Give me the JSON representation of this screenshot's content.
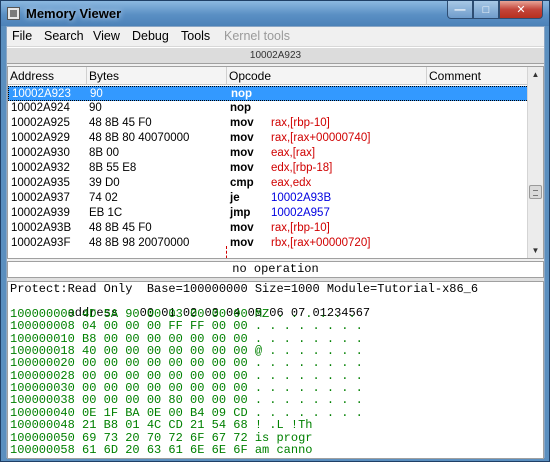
{
  "window": {
    "title": "Memory Viewer"
  },
  "menu": {
    "items": [
      "File",
      "Search",
      "View",
      "Debug",
      "Tools",
      "Kernel tools"
    ]
  },
  "address_bar": "10002A923",
  "disassembly": {
    "columns": [
      "Address",
      "Bytes",
      "Opcode",
      "Comment"
    ],
    "rows": [
      {
        "address": "10002A923",
        "bytes": "90",
        "mnemonic": "nop",
        "operands": "",
        "operand_color": "red",
        "selected": true
      },
      {
        "address": "10002A924",
        "bytes": "90",
        "mnemonic": "nop",
        "operands": "",
        "operand_color": "red",
        "selected": false
      },
      {
        "address": "10002A925",
        "bytes": "48 8B 45 F0",
        "mnemonic": "mov",
        "operands": "rax,[rbp-10]",
        "operand_color": "red",
        "selected": false
      },
      {
        "address": "10002A929",
        "bytes": "48 8B 80 40070000",
        "mnemonic": "mov",
        "operands": "rax,[rax+00000740]",
        "operand_color": "red",
        "selected": false
      },
      {
        "address": "10002A930",
        "bytes": "8B 00",
        "mnemonic": "mov",
        "operands": "eax,[rax]",
        "operand_color": "red",
        "selected": false
      },
      {
        "address": "10002A932",
        "bytes": "8B 55 E8",
        "mnemonic": "mov",
        "operands": "edx,[rbp-18]",
        "operand_color": "red",
        "selected": false
      },
      {
        "address": "10002A935",
        "bytes": "39 D0",
        "mnemonic": "cmp",
        "operands": "eax,edx",
        "operand_color": "red",
        "selected": false
      },
      {
        "address": "10002A937",
        "bytes": "74 02",
        "mnemonic": "je",
        "operands": "10002A93B",
        "operand_color": "blue",
        "selected": false
      },
      {
        "address": "10002A939",
        "bytes": "EB 1C",
        "mnemonic": "jmp",
        "operands": "10002A957",
        "operand_color": "blue",
        "selected": false
      },
      {
        "address": "10002A93B",
        "bytes": "48 8B 45 F0",
        "mnemonic": "mov",
        "operands": "rax,[rbp-10]",
        "operand_color": "red",
        "selected": false
      },
      {
        "address": "10002A93F",
        "bytes": "48 8B 98 20070000",
        "mnemonic": "mov",
        "operands": "rbx,[rax+00000720]",
        "operand_color": "red",
        "selected": false
      }
    ]
  },
  "status_text": "no operation",
  "hex_view": {
    "info_line": "Protect:Read Only  Base=100000000 Size=1000 Module=Tutorial-x86_6",
    "header": {
      "address": "address",
      "hex": "00 01 02 03 04 05 06 07",
      "ascii": "01234567"
    },
    "lines": [
      {
        "address": "100000000",
        "hex": "4D 5A 90 00 03 00 00 00",
        "ascii": "MZ . . . . . ."
      },
      {
        "address": "100000008",
        "hex": "04 00 00 00 FF FF 00 00",
        "ascii": ". . . . . . . ."
      },
      {
        "address": "100000010",
        "hex": "B8 00 00 00 00 00 00 00",
        "ascii": ". . . . . . . ."
      },
      {
        "address": "100000018",
        "hex": "40 00 00 00 00 00 00 00",
        "ascii": "@ . . . . . . ."
      },
      {
        "address": "100000020",
        "hex": "00 00 00 00 00 00 00 00",
        "ascii": ". . . . . . . ."
      },
      {
        "address": "100000028",
        "hex": "00 00 00 00 00 00 00 00",
        "ascii": ". . . . . . . ."
      },
      {
        "address": "100000030",
        "hex": "00 00 00 00 00 00 00 00",
        "ascii": ". . . . . . . ."
      },
      {
        "address": "100000038",
        "hex": "00 00 00 00 80 00 00 00",
        "ascii": ". . . . . . . ."
      },
      {
        "address": "100000040",
        "hex": "0E 1F BA 0E 00 B4 09 CD",
        "ascii": ". . . . . . . ."
      },
      {
        "address": "100000048",
        "hex": "21 B8 01 4C CD 21 54 68",
        "ascii": "! .L !Th"
      },
      {
        "address": "100000050",
        "hex": "69 73 20 70 72 6F 67 72",
        "ascii": "is progr"
      },
      {
        "address": "100000058",
        "hex": "61 6D 20 63 61 6E 6E 6F",
        "ascii": "am canno"
      }
    ]
  }
}
